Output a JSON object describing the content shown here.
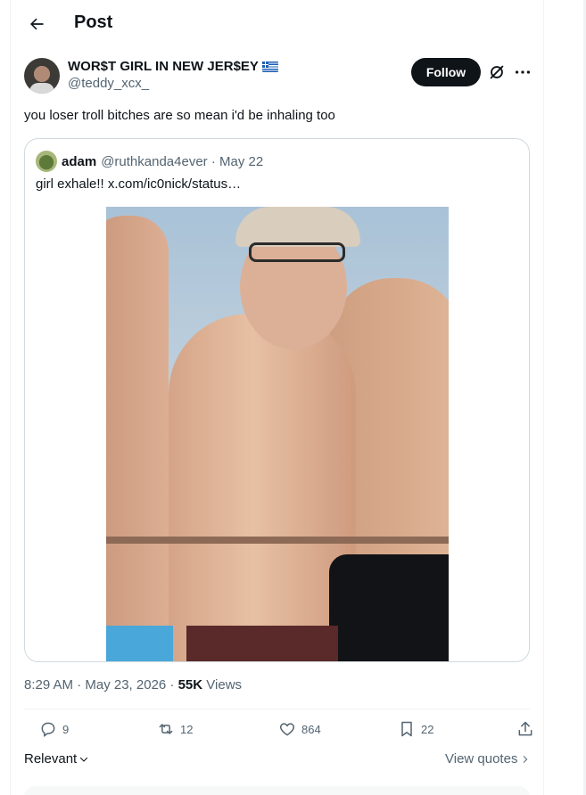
{
  "header": {
    "title": "Post"
  },
  "author": {
    "display_name": "WOR$T GIRL IN NEW JER$EY",
    "handle": "@teddy_xcx_",
    "follow_label": "Follow"
  },
  "post": {
    "text": "you loser troll bitches are so mean i'd be inhaling too",
    "time": "8:29 AM · May 23, 2026 · ",
    "views_count": "55K",
    "views_label": " Views"
  },
  "quote": {
    "name": "adam",
    "meta": "@ruthkanda4ever · May 22",
    "text": "girl exhale!!  x.com/ic0nick/status…"
  },
  "actions": {
    "replies": "9",
    "reposts": "12",
    "likes": "864",
    "bookmarks": "22"
  },
  "footer": {
    "sort_label": "Relevant",
    "view_quotes_label": "View quotes"
  },
  "colors": {
    "text": "#0f1419",
    "muted": "#536471",
    "border": "#cfd9de",
    "divider": "#eff3f4"
  },
  "icons": [
    "back-arrow-icon",
    "greek-flag-icon",
    "grok-icon",
    "more-icon",
    "reply-icon",
    "repost-icon",
    "like-icon",
    "bookmark-icon",
    "share-icon",
    "chevron-down-icon",
    "chevron-right-icon"
  ]
}
